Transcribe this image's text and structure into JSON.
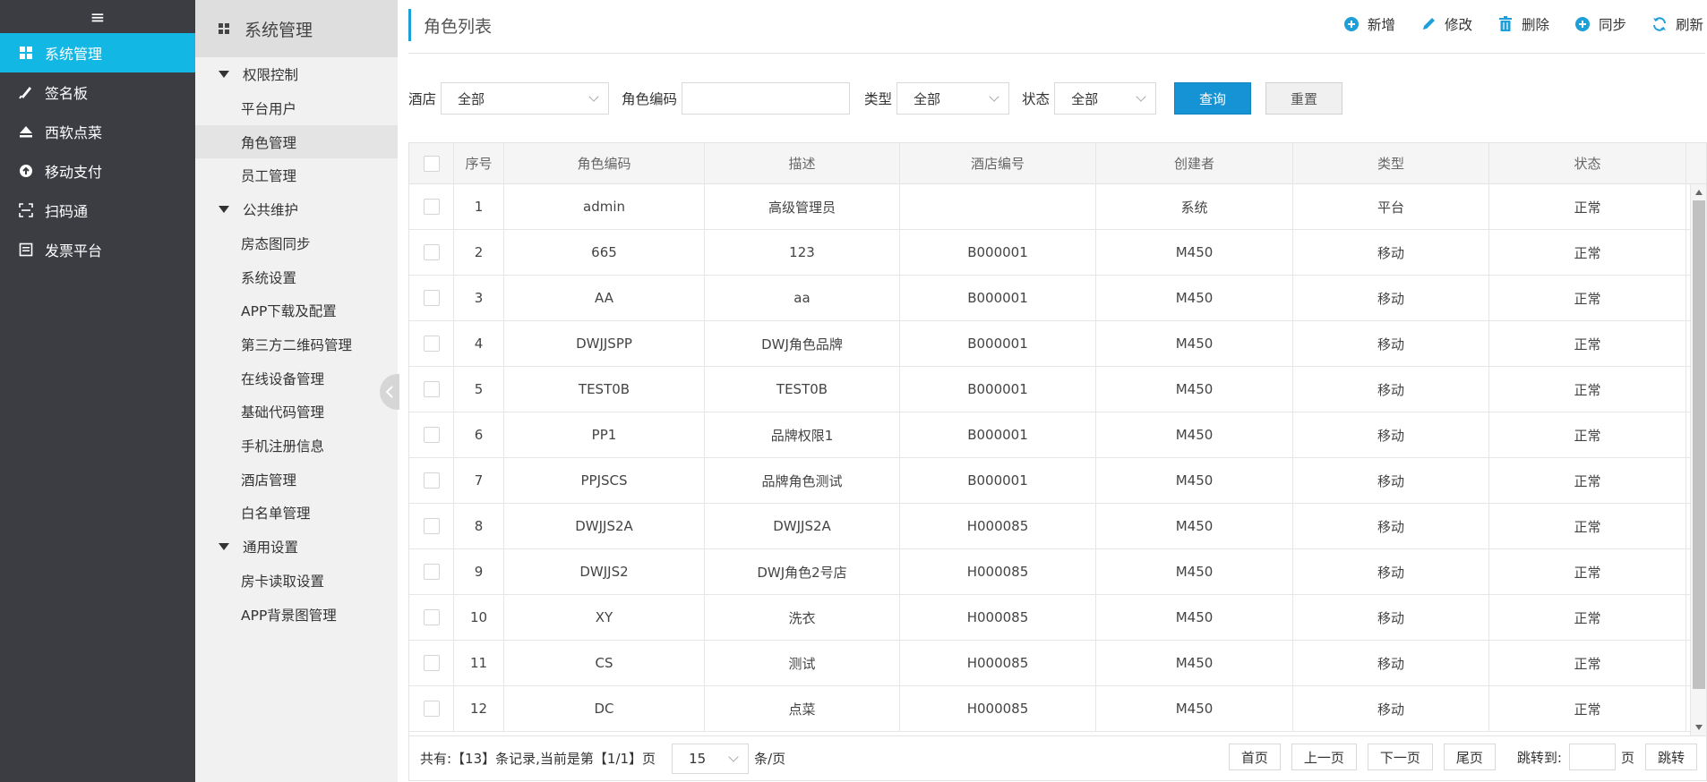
{
  "nav": {
    "toggle_glyph": "≡",
    "items": [
      {
        "label": "系统管理",
        "icon": "grid-icon",
        "active": true
      },
      {
        "label": "签名板",
        "icon": "pen-icon",
        "active": false
      },
      {
        "label": "西软点菜",
        "icon": "eject-icon",
        "active": false
      },
      {
        "label": "移动支付",
        "icon": "pay-icon",
        "active": false
      },
      {
        "label": "扫码通",
        "icon": "scan-icon",
        "active": false
      },
      {
        "label": "发票平台",
        "icon": "invoice-icon",
        "active": false
      }
    ],
    "accent": "#12b7e3"
  },
  "submenu": {
    "title": "系统管理",
    "groups": [
      {
        "label": "权限控制",
        "items": [
          "平台用户",
          "角色管理",
          "员工管理"
        ]
      },
      {
        "label": "公共维护",
        "items": [
          "房态图同步",
          "系统设置",
          "APP下载及配置",
          "第三方二维码管理",
          "在线设备管理",
          "基础代码管理",
          "手机注册信息",
          "酒店管理",
          "白名单管理"
        ]
      },
      {
        "label": "通用设置",
        "items": [
          "房卡读取设置",
          "APP背景图管理"
        ]
      }
    ],
    "active_item": "角色管理"
  },
  "page": {
    "title": "角色列表"
  },
  "toolbar": [
    {
      "label": "新增",
      "icon": "plus-circle-icon"
    },
    {
      "label": "修改",
      "icon": "pencil-icon"
    },
    {
      "label": "删除",
      "icon": "trash-icon"
    },
    {
      "label": "同步",
      "icon": "plus-circle-icon"
    },
    {
      "label": "刷新",
      "icon": "refresh-icon"
    }
  ],
  "filters": {
    "hotel_label": "酒店",
    "hotel_value": "全部",
    "code_label": "角色编码",
    "code_value": "",
    "type_label": "类型",
    "type_value": "全部",
    "status_label": "状态",
    "status_value": "全部",
    "query_label": "查询",
    "reset_label": "重置"
  },
  "table": {
    "columns": [
      "序号",
      "角色编码",
      "描述",
      "酒店编号",
      "创建者",
      "类型",
      "状态"
    ],
    "rows": [
      [
        "1",
        "admin",
        "高级管理员",
        "",
        "系统",
        "平台",
        "正常"
      ],
      [
        "2",
        "665",
        "123",
        "B000001",
        "M450",
        "移动",
        "正常"
      ],
      [
        "3",
        "AA",
        "aa",
        "B000001",
        "M450",
        "移动",
        "正常"
      ],
      [
        "4",
        "DWJJSPP",
        "DWJ角色品牌",
        "B000001",
        "M450",
        "移动",
        "正常"
      ],
      [
        "5",
        "TEST0B",
        "TEST0B",
        "B000001",
        "M450",
        "移动",
        "正常"
      ],
      [
        "6",
        "PP1",
        "品牌权限1",
        "B000001",
        "M450",
        "移动",
        "正常"
      ],
      [
        "7",
        "PPJSCS",
        "品牌角色测试",
        "B000001",
        "M450",
        "移动",
        "正常"
      ],
      [
        "8",
        "DWJJS2A",
        "DWJJS2A",
        "H000085",
        "M450",
        "移动",
        "正常"
      ],
      [
        "9",
        "DWJJS2",
        "DWJ角色2号店",
        "H000085",
        "M450",
        "移动",
        "正常"
      ],
      [
        "10",
        "XY",
        "洗衣",
        "H000085",
        "M450",
        "移动",
        "正常"
      ],
      [
        "11",
        "CS",
        "测试",
        "H000085",
        "M450",
        "移动",
        "正常"
      ],
      [
        "12",
        "DC",
        "点菜",
        "H000085",
        "M450",
        "移动",
        "正常"
      ]
    ]
  },
  "pager": {
    "info": "共有:【13】条记录,当前是第【1/1】页",
    "page_size": "15",
    "unit": "条/页",
    "first": "首页",
    "prev": "上一页",
    "next": "下一页",
    "last": "尾页",
    "jump_label": "跳转到:",
    "page_label": "页",
    "jump_button": "跳转"
  }
}
